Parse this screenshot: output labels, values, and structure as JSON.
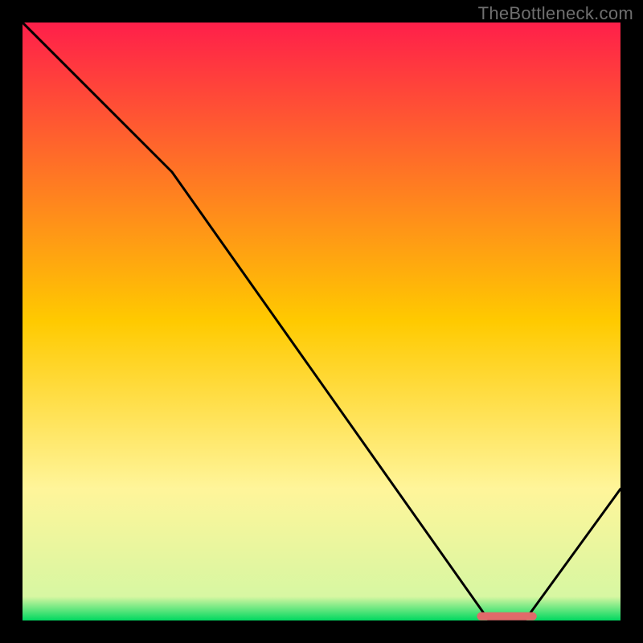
{
  "watermark": "TheBottleneck.com",
  "colors": {
    "bg": "#000000",
    "top": "#ff1f4a",
    "mid": "#ffca00",
    "low": "#fff59a",
    "green": "#00d860",
    "curve": "#000000",
    "marker": "#e06a6a"
  },
  "chart_data": {
    "type": "line",
    "title": "",
    "xlabel": "",
    "ylabel": "",
    "xlim": [
      0,
      100
    ],
    "ylim": [
      0,
      100
    ],
    "series": [
      {
        "name": "curve",
        "x": [
          0,
          25,
          78,
          84,
          100
        ],
        "values": [
          100,
          75,
          0,
          0,
          22
        ]
      }
    ],
    "marker": {
      "x_start": 76,
      "x_end": 86,
      "y": 0.7
    },
    "gradient_stops": [
      {
        "pct": 0,
        "color": "#ff1f4a"
      },
      {
        "pct": 50,
        "color": "#ffca00"
      },
      {
        "pct": 78,
        "color": "#fff59a"
      },
      {
        "pct": 96,
        "color": "#d7f7a2"
      },
      {
        "pct": 100,
        "color": "#00d860"
      }
    ]
  }
}
